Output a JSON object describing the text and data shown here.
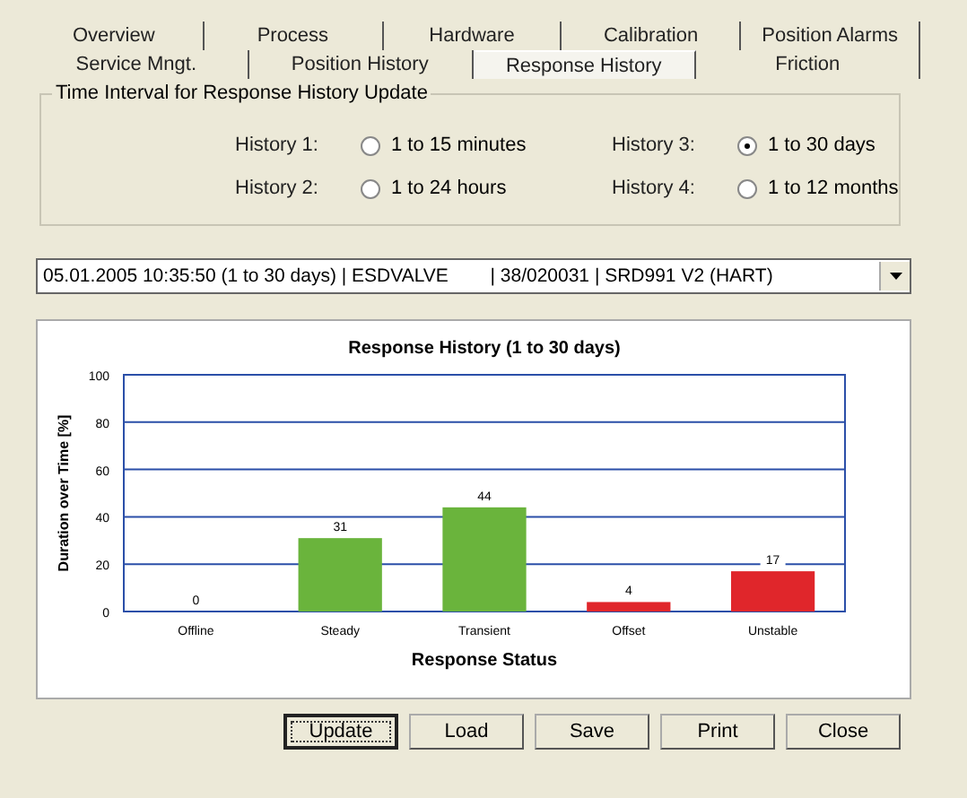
{
  "tabs": [
    [
      {
        "label": "Overview",
        "selected": false
      },
      {
        "label": "Process",
        "selected": false
      },
      {
        "label": "Hardware",
        "selected": false
      },
      {
        "label": "Calibration",
        "selected": false
      },
      {
        "label": "Position Alarms",
        "selected": false
      }
    ],
    [
      {
        "label": "Service Mngt.",
        "selected": false
      },
      {
        "label": "Position History",
        "selected": false
      },
      {
        "label": "Response History",
        "selected": true
      },
      {
        "label": "Friction",
        "selected": false
      }
    ]
  ],
  "interval_group": {
    "title": "Time Interval for Response History Update",
    "options": [
      {
        "label": "History 1:",
        "value": "1 to 15 minutes",
        "selected": false
      },
      {
        "label": "History 3:",
        "value": "1 to 30 days",
        "selected": true
      },
      {
        "label": "History 2:",
        "value": "1 to 24 hours",
        "selected": false
      },
      {
        "label": "History 4:",
        "value": "1 to 12 months",
        "selected": false
      }
    ]
  },
  "record_select": {
    "value": "05.01.2005 10:35:50 (1 to 30 days) | ESDVALVE        | 38/020031 | SRD991 V2 (HART)"
  },
  "chart": {
    "chart_data": {
      "type": "bar",
      "title": "Response History (1 to 30 days)",
      "xlabel": "Response Status",
      "ylabel": "Duration over Time [%]",
      "categories": [
        "Offline",
        "Steady",
        "Transient",
        "Offset",
        "Unstable"
      ],
      "series": [
        {
          "values": [
            0,
            31,
            44,
            4,
            17
          ]
        }
      ],
      "grid": true,
      "colors": [
        "#6ab43c",
        "#6ab43c",
        "#6ab43c",
        "#e0262b",
        "#e0262b"
      ],
      "ylim": [
        0,
        100
      ],
      "yticks": [
        0,
        20,
        40,
        60,
        80,
        100
      ],
      "data_labels": true
    }
  },
  "buttons": [
    {
      "label": "Update",
      "selected": true
    },
    {
      "label": "Load",
      "selected": false
    },
    {
      "label": "Save",
      "selected": false
    },
    {
      "label": "Print",
      "selected": false
    },
    {
      "label": "Close",
      "selected": false
    }
  ]
}
